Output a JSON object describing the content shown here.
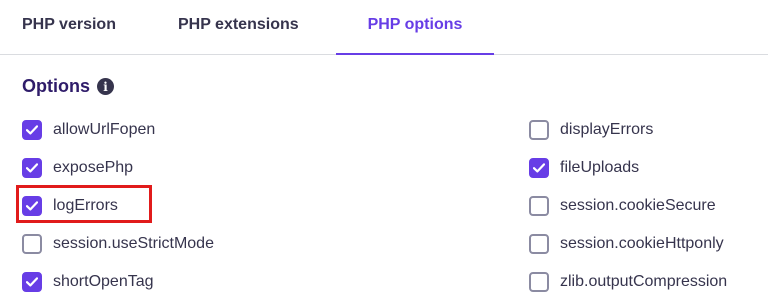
{
  "tabs": [
    {
      "label": "PHP version",
      "active": false
    },
    {
      "label": "PHP extensions",
      "active": false
    },
    {
      "label": "PHP options",
      "active": true
    }
  ],
  "section": {
    "title": "Options",
    "info_icon": "info-icon"
  },
  "options_left": [
    {
      "label": "allowUrlFopen",
      "checked": true
    },
    {
      "label": "exposePhp",
      "checked": true
    },
    {
      "label": "logErrors",
      "checked": true
    },
    {
      "label": "session.useStrictMode",
      "checked": false
    },
    {
      "label": "shortOpenTag",
      "checked": true
    }
  ],
  "options_right": [
    {
      "label": "displayErrors",
      "checked": false
    },
    {
      "label": "fileUploads",
      "checked": true
    },
    {
      "label": "session.cookieSecure",
      "checked": false
    },
    {
      "label": "session.cookieHttponly",
      "checked": false
    },
    {
      "label": "zlib.outputCompression",
      "checked": false
    }
  ],
  "colors": {
    "accent": "#673de6",
    "highlight": "#e11b1b",
    "text": "#36344d"
  }
}
